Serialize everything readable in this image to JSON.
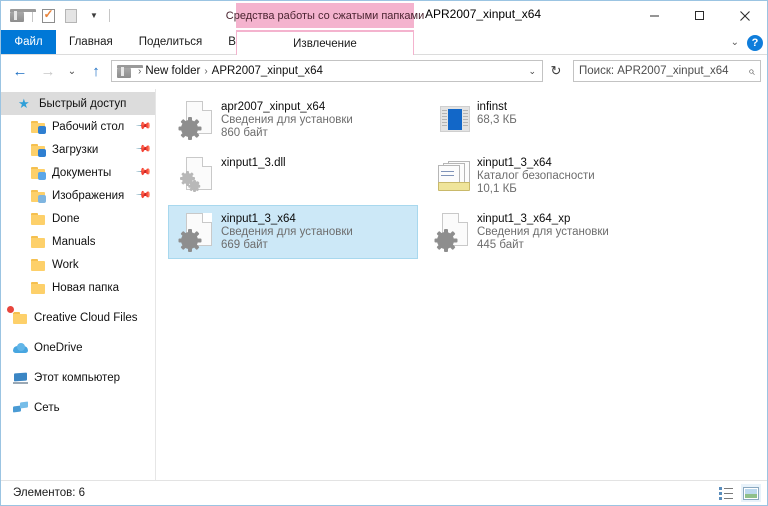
{
  "window": {
    "title": "APR2007_xinput_x64",
    "minimize_label": "Свернуть",
    "maximize_label": "Развернуть",
    "close_label": "Закрыть"
  },
  "quick_access_toolbar": {
    "items": [
      {
        "name": "zip-folder-icon",
        "label": "APR2007_xinput_x64"
      },
      {
        "name": "properties-icon",
        "label": "Свойства"
      },
      {
        "name": "new-folder-icon",
        "label": "Создать папку"
      },
      {
        "name": "customize-caret",
        "label": "Настроить панель быстрого доступа"
      }
    ]
  },
  "ribbon": {
    "contextual_header": "Средства работы со сжатыми папками",
    "contextual_tab": "Извлечение",
    "tabs": [
      {
        "label": "Файл",
        "active": false,
        "type": "file"
      },
      {
        "label": "Главная",
        "active": false,
        "type": "normal"
      },
      {
        "label": "Поделиться",
        "active": false,
        "type": "normal"
      },
      {
        "label": "Вид",
        "active": false,
        "type": "normal"
      }
    ],
    "collapse_caret": "⌄",
    "help_label": "?"
  },
  "navbar": {
    "back": "←",
    "forward": "→",
    "recent": "⌄",
    "up": "↑",
    "breadcrumbs": [
      {
        "label": "New folder"
      },
      {
        "label": "APR2007_xinput_x64"
      }
    ],
    "breadcrumb_caret": "⌄",
    "refresh": "↻",
    "search_placeholder": "Поиск: APR2007_xinput_x64"
  },
  "sidebar": {
    "items": [
      {
        "label": "Быстрый доступ",
        "icon": "star-icon",
        "level": "root",
        "pinned": false
      },
      {
        "label": "Рабочий стол",
        "icon": "desktop-folder-icon",
        "level": "lvl1",
        "pinned": true
      },
      {
        "label": "Загрузки",
        "icon": "downloads-folder-icon",
        "level": "lvl1",
        "pinned": true
      },
      {
        "label": "Документы",
        "icon": "documents-folder-icon",
        "level": "lvl1",
        "pinned": true
      },
      {
        "label": "Изображения",
        "icon": "pictures-folder-icon",
        "level": "lvl1",
        "pinned": true
      },
      {
        "label": "Done",
        "icon": "folder-icon",
        "level": "lvl1",
        "pinned": false
      },
      {
        "label": "Manuals",
        "icon": "folder-icon",
        "level": "lvl1",
        "pinned": false
      },
      {
        "label": "Work",
        "icon": "folder-icon",
        "level": "lvl1",
        "pinned": false
      },
      {
        "label": "Новая папка",
        "icon": "folder-icon",
        "level": "lvl1",
        "pinned": false
      },
      {
        "label": "Creative Cloud Files",
        "icon": "creative-cloud-icon",
        "level": "lvl0",
        "pinned": false
      },
      {
        "label": "OneDrive",
        "icon": "onedrive-icon",
        "level": "lvl0",
        "pinned": false
      },
      {
        "label": "Этот компьютер",
        "icon": "this-pc-icon",
        "level": "lvl0",
        "pinned": false
      },
      {
        "label": "Сеть",
        "icon": "network-icon",
        "level": "lvl0",
        "pinned": false
      }
    ]
  },
  "files": [
    {
      "name": "apr2007_xinput_x64",
      "type": "Сведения для установки",
      "size": "860 байт",
      "icon": "inf-file-icon",
      "selected": false
    },
    {
      "name": "infinst",
      "type": "",
      "size": "68,3 КБ",
      "icon": "exe-file-icon",
      "selected": false
    },
    {
      "name": "xinput1_3.dll",
      "type": "",
      "size": "",
      "icon": "dll-file-icon",
      "selected": false
    },
    {
      "name": "xinput1_3_x64",
      "type": "Каталог безопасности",
      "size": "10,1 КБ",
      "icon": "security-catalog-icon",
      "selected": false
    },
    {
      "name": "xinput1_3_x64",
      "type": "Сведения для установки",
      "size": "669 байт",
      "icon": "inf-file-icon",
      "selected": true
    },
    {
      "name": "xinput1_3_x64_xp",
      "type": "Сведения для установки",
      "size": "445 байт",
      "icon": "inf-file-icon",
      "selected": false
    }
  ],
  "statusbar": {
    "item_count": "Элементов: 6",
    "view_details_label": "Таблица",
    "view_large_icons_label": "Крупные значки"
  },
  "colors": {
    "accent": "#0078d7",
    "contextual_tab": "#f4b3ce",
    "selection": "#cce8f7",
    "help_blue": "#0f7ddb"
  }
}
